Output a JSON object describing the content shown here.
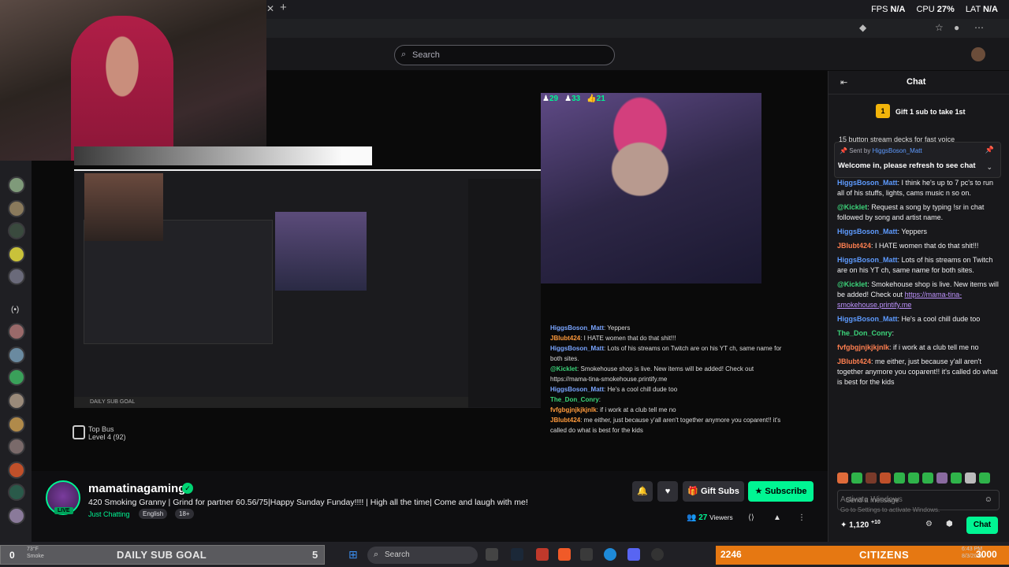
{
  "overlay": {
    "fps_label": "FPS",
    "fps_value": "N/A",
    "cpu_label": "CPU",
    "cpu_value": "27%",
    "lat_label": "LAT",
    "lat_value": "N/A"
  },
  "header": {
    "search_placeholder": "Search"
  },
  "video": {
    "viewer_counts": [
      "29",
      "33",
      "21"
    ],
    "top_bus_label": "Top Bus",
    "top_bus_level": "Level 4 (92)",
    "overlay_chat": [
      {
        "user": "HiggsBoson_Matt",
        "text": ": Yeppers",
        "color": "#7aa5ff"
      },
      {
        "user": "JBlubt424",
        "text": ": I HATE women that do that shit!!!",
        "color": "#ff9a3c"
      },
      {
        "user": "HiggsBoson_Matt",
        "text": ": Lots of his streams on Twitch are on his YT ch, same name for both sites.",
        "color": "#7aa5ff"
      },
      {
        "user": "@Kicklet",
        "text": ": Smokehouse shop is live. New items will be added! Check out https://mama-tina-smokehouse.printify.me",
        "color": "#3cd47a"
      },
      {
        "user": "HiggsBoson_Matt",
        "text": ": He's a cool chill dude too",
        "color": "#7aa5ff"
      },
      {
        "user": "The_Don_Conry",
        "text": ":",
        "color": "#3cd47a"
      },
      {
        "user": "fvfgbgjnjkjkjnlk",
        "text": ": if i work at a club tell me no",
        "color": "#ff9a3c"
      },
      {
        "user": "JBlubt424",
        "text": ": me either, just because y'all aren't together anymore you coparent!! it's called do what is best for the kids",
        "color": "#ff9a3c"
      }
    ]
  },
  "stream": {
    "channel_name": "mamatinagaming",
    "live": "LIVE",
    "title": "420 Smoking Granny | Grind for partner 60.56/75|Happy Sunday Funday!!!! | High all the time| Come and laugh with me!",
    "category": "Just Chatting",
    "tags": [
      "English",
      "18+"
    ],
    "gift_label": "Gift Subs",
    "subscribe_label": "Subscribe",
    "viewers_value": "27",
    "viewers_label": "Viewers"
  },
  "chat": {
    "title": "Chat",
    "gift_lead": "Gift 1 sub to take 1st",
    "gift_count": "1",
    "ticker": "15 button stream decks for fast voice",
    "pinned_sent_by": "Sent by",
    "pinned_user": "HiggsBoson_Matt",
    "pinned_message": "Welcome in, please refresh to see chat",
    "messages": [
      {
        "user": "HiggsBoson_Matt",
        "text": ": I think he's up to 7 pc's to run all of his stuffs, lights, cams music n so on.",
        "color": "#5e9bff"
      },
      {
        "user": "@Kicklet",
        "text": ": Request a song by typing !sr in chat followed by song and artist name.",
        "color": "#3cd47a"
      },
      {
        "user": "HiggsBoson_Matt",
        "text": ": Yeppers",
        "color": "#5e9bff"
      },
      {
        "user": "JBlubt424",
        "text": ": I HATE women that do that shit!!!",
        "color": "#ff7f50"
      },
      {
        "user": "HiggsBoson_Matt",
        "text": ": Lots of his streams on Twitch are on his YT ch, same name for both sites.",
        "color": "#5e9bff"
      },
      {
        "user": "@Kicklet",
        "text": ": Smokehouse shop is live. New items will be added! Check out ",
        "link": "https://mama-tina-smokehouse.printify.me",
        "color": "#3cd47a"
      },
      {
        "user": "HiggsBoson_Matt",
        "text": ": He's a cool chill dude too",
        "color": "#5e9bff"
      },
      {
        "user": "The_Don_Conry",
        "text": ":",
        "color": "#3cd47a"
      },
      {
        "user": "fvfgbgjnjkjkjnlk",
        "text": ": if i work at a club tell me no",
        "color": "#ff7f50"
      },
      {
        "user": "JBlubt424",
        "text": ": me either, just because y'all aren't together anymore you coparent!! it's called do what is best for the kids",
        "color": "#ff7f50"
      }
    ],
    "input_placeholder": "Send a message",
    "activate_line1": "Activate Windows",
    "activate_line2": "Go to Settings to activate Windows.",
    "points": "1,120",
    "points_delta": "+10",
    "send_label": "Chat"
  },
  "taskbar": {
    "goal_left": "0",
    "weather_temp": "73°F",
    "weather_cond": "Smoke",
    "goal_label": "DAILY SUB GOAL",
    "goal_value": "5",
    "search_label": "Search",
    "citizens_left": "2246",
    "citizens_label": "CITIZENS",
    "citizens_right": "3000",
    "time": "6:43 PM",
    "date": "8/3/2025"
  },
  "colors": {
    "accent": "#00f593",
    "citizens_bar": "#e67812",
    "background": "#0e0e10"
  }
}
